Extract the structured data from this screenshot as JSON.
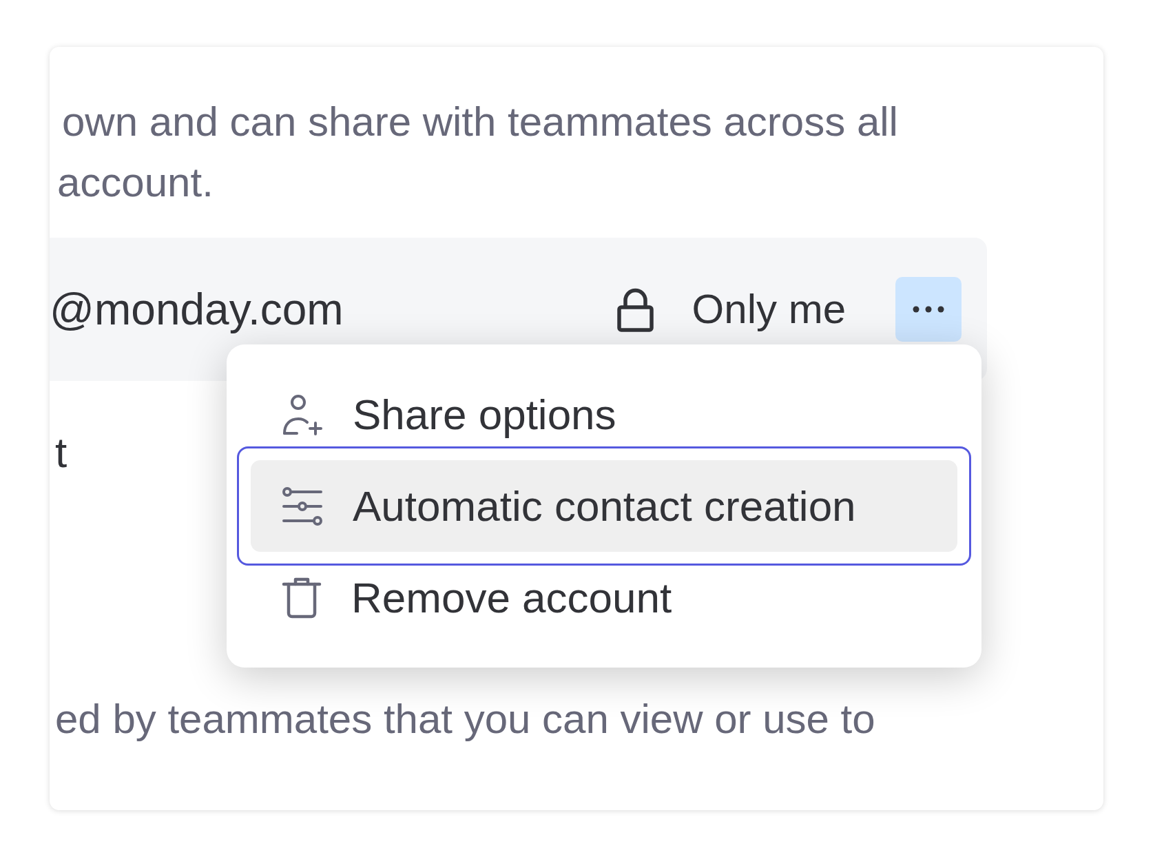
{
  "description": {
    "lines": [
      "own and can share with teammates across all",
      "account."
    ]
  },
  "account_row": {
    "email": "@monday.com",
    "visibility": "Only me",
    "menu_open": true
  },
  "menu": {
    "items": [
      {
        "label": "Share options",
        "kind": "share",
        "selected": false
      },
      {
        "label": "Automatic contact creation",
        "kind": "configure",
        "selected": true
      },
      {
        "label": "Remove account",
        "kind": "delete",
        "selected": false
      }
    ]
  },
  "heading": "t",
  "description_2": {
    "lines": [
      "ed by teammates that you can view or use to"
    ]
  }
}
